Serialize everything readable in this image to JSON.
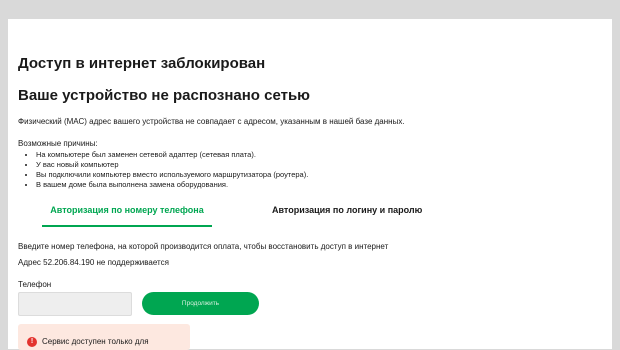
{
  "page": {
    "title": "Доступ в интернет заблокирован",
    "subtitle": "Ваше устройство не распознано сетью",
    "mac_note": "Физический (МАС) адрес вашего устройства не совпадает с адресом, указанным в нашей базе данных.",
    "reasons_title": "Возможные причины:",
    "reasons": [
      "На компьютере был заменен сетевой адаптер (сетевая плата).",
      "У вас новый компьютер",
      "Вы подключили компьютер вместо используемого маршрутизатора (роутера).",
      "В вашем доме была выполнена замена оборудования."
    ]
  },
  "tabs": [
    {
      "label": "Авторизация по номеру телефона",
      "active": true
    },
    {
      "label": "Авторизация по логину и паролю",
      "active": false
    }
  ],
  "form": {
    "hint": "Введите номер телефона, на которой производится оплата, чтобы восстановить доступ в интернет",
    "address_note": "Адрес 52.206.84.190 не поддерживается",
    "phone_label": "Телефон",
    "phone_value": "",
    "continue_label": "Продолжить"
  },
  "alert": {
    "icon": "exclamation-icon",
    "text": "Сервис доступен только для"
  },
  "colors": {
    "accent": "#00a651",
    "alert_bg": "#fde8e0",
    "alert_icon": "#e3342f",
    "page_bg": "#d9d9d9"
  }
}
